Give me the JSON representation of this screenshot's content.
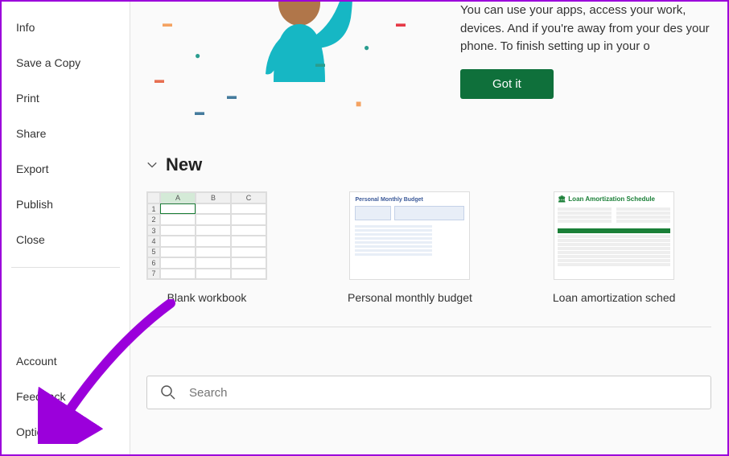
{
  "sidebar": {
    "top": [
      {
        "label": "Info",
        "name": "sidebar-item-info"
      },
      {
        "label": "Save a Copy",
        "name": "sidebar-item-save-copy"
      },
      {
        "label": "Print",
        "name": "sidebar-item-print"
      },
      {
        "label": "Share",
        "name": "sidebar-item-share"
      },
      {
        "label": "Export",
        "name": "sidebar-item-export"
      },
      {
        "label": "Publish",
        "name": "sidebar-item-publish"
      },
      {
        "label": "Close",
        "name": "sidebar-item-close"
      }
    ],
    "bottom": [
      {
        "label": "Account",
        "name": "sidebar-item-account"
      },
      {
        "label": "Feedback",
        "name": "sidebar-item-feedback"
      },
      {
        "label": "Options",
        "name": "sidebar-item-options"
      }
    ]
  },
  "hero": {
    "text": "You can use your apps, access your work, devices. And if you're away from your des your phone. To finish setting up in your o",
    "button_label": "Got it"
  },
  "section": {
    "new_title": "New"
  },
  "templates": [
    {
      "label": "Blank workbook",
      "name": "template-blank-workbook"
    },
    {
      "label": "Personal monthly budget",
      "name": "template-personal-monthly-budget",
      "thumb_title": "Personal Monthly Budget"
    },
    {
      "label": "Loan amortization sched",
      "name": "template-loan-amortization",
      "thumb_title": "Loan Amortization Schedule"
    }
  ],
  "search": {
    "placeholder": "Search"
  },
  "colors": {
    "accent_green": "#0f703b",
    "annotation_purple": "#9b00db"
  }
}
